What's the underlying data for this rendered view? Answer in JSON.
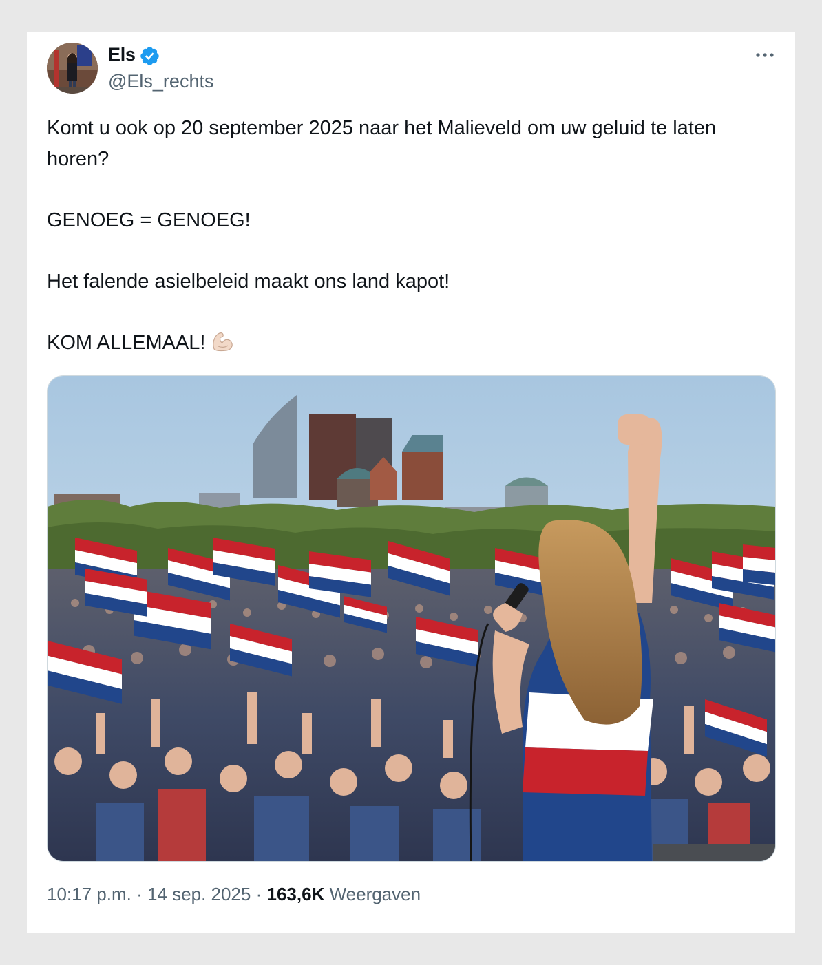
{
  "author": {
    "display_name": "Els",
    "handle": "@Els_rechts",
    "verified": true,
    "avatar_icon": "profile-photo"
  },
  "menu": {
    "icon": "more-dots-icon"
  },
  "tweet": {
    "line1": "Komt u ook op 20 september 2025 naar het Malieveld om uw geluid te laten horen?",
    "line2": "GENOEG = GENOEG!",
    "line3": "Het falende asielbeleid maakt ons land kapot!",
    "line4": "KOM ALLEMAAL!",
    "emoji_icon": "flexed-biceps-icon"
  },
  "media": {
    "icon": "rally-photo"
  },
  "meta": {
    "time": "10:17 p.m.",
    "separator": "·",
    "date": "14 sep. 2025",
    "views_count": "163,6K",
    "views_label": "Weergaven"
  },
  "colors": {
    "text": "#0f1419",
    "secondary": "#536471",
    "verified_blue": "#1d9bf0",
    "flag_red": "#c8232c",
    "flag_white": "#ffffff",
    "flag_blue": "#21468b"
  }
}
